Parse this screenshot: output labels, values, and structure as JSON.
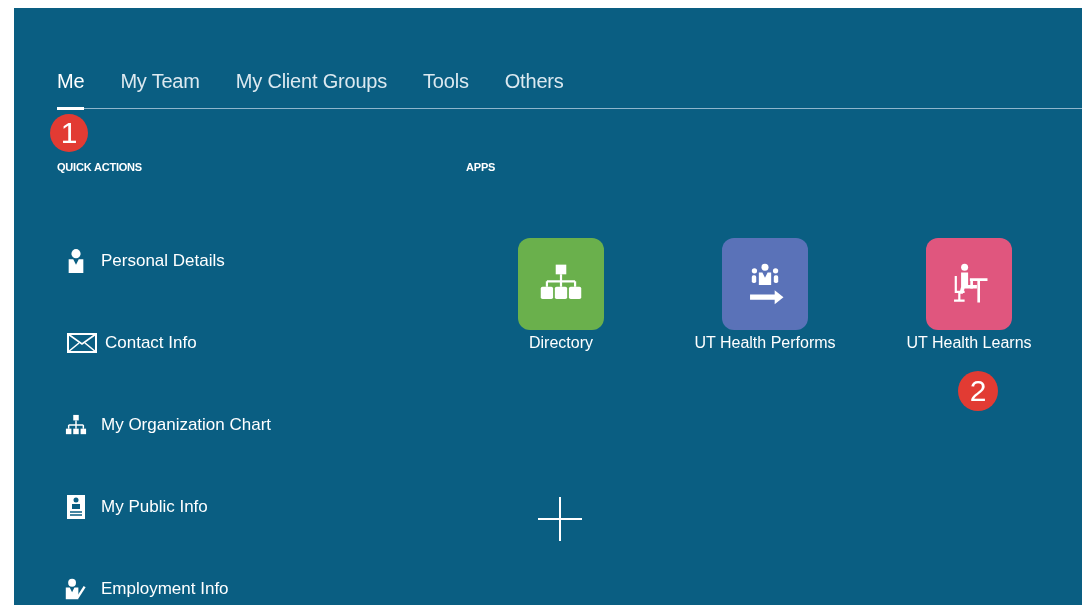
{
  "tabs": [
    {
      "label": "Me",
      "selected": true
    },
    {
      "label": "My Team",
      "selected": false
    },
    {
      "label": "My Client Groups",
      "selected": false
    },
    {
      "label": "Tools",
      "selected": false
    },
    {
      "label": "Others",
      "selected": false
    }
  ],
  "quick_actions": {
    "heading": "QUICK ACTIONS",
    "items": [
      {
        "label": "Personal Details",
        "kind": "person"
      },
      {
        "label": "Contact Info",
        "kind": "mail"
      },
      {
        "label": "My Organization Chart",
        "kind": "org"
      },
      {
        "label": "My Public Info",
        "kind": "badge"
      },
      {
        "label": "Employment Info",
        "kind": "edit"
      }
    ]
  },
  "apps": {
    "heading": "APPS",
    "items": [
      {
        "label": "Directory",
        "kind": "org",
        "color": "#6ab04c"
      },
      {
        "label": "UT Health Performs",
        "kind": "team",
        "color": "#5a72b8"
      },
      {
        "label": "UT Health Learns",
        "kind": "desk",
        "color": "#e0567e"
      }
    ]
  },
  "callouts": [
    "1",
    "2"
  ]
}
